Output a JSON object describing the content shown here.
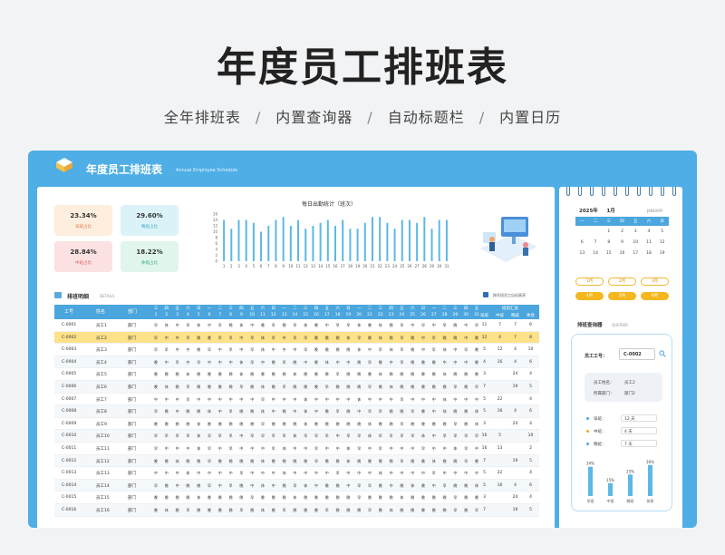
{
  "hero": {
    "title": "年度员工排班表",
    "features": [
      "全年排班表",
      "内置查询器",
      "自动标题栏",
      "内置日历"
    ],
    "separator": "/"
  },
  "app": {
    "title": "年度员工排班表",
    "subtitle": "Annual Employee Schedule",
    "colors": {
      "frame": "#4eaee5",
      "header": "#4aa6dd",
      "highlight": "#fde28a",
      "accent": "#f5b71f"
    }
  },
  "stats": [
    {
      "pct": "23.34%",
      "label": "早班占比"
    },
    {
      "pct": "29.60%",
      "label": "晚班占比"
    },
    {
      "pct": "28.84%",
      "label": "中班占比"
    },
    {
      "pct": "18.22%",
      "label": "休假占比"
    }
  ],
  "chart_data": {
    "type": "bar",
    "title": "每日出勤统计（班次）",
    "categories": [
      "1",
      "2",
      "3",
      "4",
      "5",
      "6",
      "7",
      "8",
      "9",
      "10",
      "11",
      "12",
      "13",
      "14",
      "15",
      "16",
      "17",
      "18",
      "19",
      "20",
      "21",
      "22",
      "23",
      "24",
      "25",
      "26",
      "27",
      "28",
      "29",
      "30",
      "31"
    ],
    "values": [
      14,
      11,
      14,
      14,
      13,
      10,
      12,
      14,
      15,
      12,
      14,
      11,
      12,
      13,
      14,
      12,
      14,
      11,
      11,
      13,
      15,
      15,
      13,
      11,
      14,
      14,
      13,
      15,
      11,
      14,
      14
    ],
    "ylim": [
      0,
      16
    ],
    "yticks": [
      "0",
      "2",
      "4",
      "6",
      "8",
      "10",
      "12",
      "14",
      "16"
    ],
    "color": "#5cb8e6"
  },
  "table": {
    "title": "排班明细",
    "subtitle": "DETAILS",
    "checkbox_label": "按早班员工自动高亮",
    "headers": {
      "id": "工号",
      "name": "姓名",
      "dept": "部门"
    },
    "weekdays": [
      "三",
      "四",
      "五",
      "六",
      "日",
      "一",
      "二",
      "三",
      "四",
      "五",
      "六",
      "日",
      "一",
      "二",
      "三",
      "四",
      "五",
      "六",
      "日",
      "一",
      "二",
      "三",
      "四",
      "五",
      "六",
      "日",
      "一",
      "二",
      "三",
      "四",
      "五"
    ],
    "days": [
      "1",
      "2",
      "3",
      "4",
      "5",
      "6",
      "7",
      "8",
      "9",
      "10",
      "11",
      "12",
      "13",
      "14",
      "15",
      "16",
      "17",
      "18",
      "19",
      "20",
      "21",
      "22",
      "23",
      "24",
      "25",
      "26",
      "27",
      "28",
      "29",
      "30",
      "31"
    ],
    "summary_title": "班组汇总",
    "summary_headers": [
      "早班",
      "中班",
      "晚班",
      "休息"
    ],
    "rows": [
      {
        "id": "C-0001",
        "name": "员工1",
        "dept": "部门",
        "shifts": "早休中早休中早晚休中晚早晚早休晚中早早休晚休晚早中早中早晚中早",
        "sums": [
          "11",
          "7",
          "7",
          "6"
        ]
      },
      {
        "id": "C-0002",
        "name": "员工2",
        "dept": "部门",
        "shifts": "早中中早晚晚早早中早休早中早早晚晚晚休早晚休晚早晚中早晚晚中晚",
        "sums": [
          "12",
          "4",
          "7",
          "8"
        ]
      },
      {
        "id": "C-0003",
        "name": "员工3",
        "dept": "部门",
        "shifts": "早早中中晚早中早中早休中中中早晚晚晚晚休中早休早晚中早休中早晚",
        "sums": [
          "5",
          "12",
          "4",
          "10"
        ]
      },
      {
        "id": "C-0004",
        "name": "员工4",
        "dept": "部门",
        "shifts": "晚中早中早中中中休早中晚早晚中晚休中中晚早晚中早晚晚晚中中中晚",
        "sums": [
          "4",
          "16",
          "4",
          "6"
        ]
      },
      {
        "id": "C-0005",
        "name": "员工5",
        "dept": "部门",
        "shifts": "晚晚晚休晚晚晚晚休晚晚晚晚休晚晚晚早晚晚晚休晚晚晚晚晚休晚晚晚",
        "sums": [
          "3",
          "",
          "24",
          "4"
        ]
      },
      {
        "id": "C-0006",
        "name": "员工6",
        "dept": "部门",
        "shifts": "晚休晚早晚晚晚晚早晚休晚早晚晚晚早晚晚晚早晚休晚晚晚晚晚早晚早",
        "sums": [
          "7",
          "",
          "19",
          "5"
        ]
      },
      {
        "id": "C-0007",
        "name": "员工7",
        "dept": "部门",
        "shifts": "中中中早中中中中中中早中中中休中中中中休中中中早中中中休中中中",
        "sums": [
          "5",
          "22",
          "",
          "4"
        ]
      },
      {
        "id": "C-0008",
        "name": "员工8",
        "dept": "部门",
        "shifts": "早晚中晚晚休中早晚晚休中晚中休中晚早晚中早早晚晚早晚中休晚晚休",
        "sums": [
          "5",
          "16",
          "4",
          "6"
        ]
      },
      {
        "id": "C-0009",
        "name": "员工9",
        "dept": "部门",
        "shifts": "晚晚晚晚休晚晚晚晚晚早晚晚晚休晚晚晚晚晚休晚晚早晚晚晚晚早晚休",
        "sums": [
          "3",
          "",
          "24",
          "4"
        ]
      },
      {
        "id": "C-0010",
        "name": "员工10",
        "dept": "部门",
        "shifts": "早早早早休早早早中早早早早休早早早中早早休早早早早休中早早早早",
        "sums": [
          "16",
          "5",
          "",
          "10"
        ]
      },
      {
        "id": "C-0011",
        "name": "员工11",
        "dept": "部门",
        "shifts": "早中中中休早中早中中中早休中中早中中休早中早中中中早中中休早中",
        "sums": [
          "16",
          "13",
          "",
          "2"
        ]
      },
      {
        "id": "C-0012",
        "name": "员工12",
        "dept": "部门",
        "shifts": "晚晚休晚晚早晚晚晚晚休晚晚晚晚早晚晚休晚晚晚晚早晚晚休晚晚早晚",
        "sums": [
          "7",
          "",
          "19",
          "5"
        ]
      },
      {
        "id": "C-0013",
        "name": "员工13",
        "dept": "部门",
        "shifts": "中中中休中中中中早中中中休中中中中早中中中休中中中中早中中中中",
        "sums": [
          "5",
          "22",
          "",
          "4"
        ]
      },
      {
        "id": "C-0014",
        "name": "员工14",
        "dept": "部门",
        "shifts": "早晚中晚晚早中早晚中休中晚早休中晚晚中早早晚中晚休晚中早晚晚休",
        "sums": [
          "5",
          "16",
          "4",
          "6"
        ]
      },
      {
        "id": "C-0015",
        "name": "员工15",
        "dept": "部门",
        "shifts": "晚晚晚晚休晚晚晚晚早晚晚晚休晚晚晚晚晚早晚晚晚休晚晚晚晚早晚晚",
        "sums": [
          "3",
          "",
          "24",
          "4"
        ]
      },
      {
        "id": "C-0016",
        "name": "员工16",
        "dept": "部门",
        "shifts": "晚休晚早晚晚晚晚早晚休晚早晚晚晚早晚晚晚早晚休晚晚晚晚晚早晚早",
        "sums": [
          "7",
          "",
          "19",
          "5"
        ]
      }
    ],
    "highlight_row": 1
  },
  "calendar": {
    "year_label": "2025年",
    "month_label": "1月",
    "month_en": "JANUARY",
    "weekdays": [
      "一",
      "二",
      "三",
      "四",
      "五",
      "六",
      "日"
    ],
    "weeks": [
      [
        "",
        "",
        "1",
        "2",
        "3",
        "4",
        "5"
      ],
      [
        "6",
        "7",
        "8",
        "9",
        "10",
        "11",
        "12"
      ],
      [
        "13",
        "14",
        "15",
        "16",
        "17",
        "18",
        "19"
      ]
    ],
    "months": [
      "1月",
      "2月",
      "3月",
      "4月",
      "5月",
      "6月"
    ],
    "selected_month": 0
  },
  "query": {
    "title": "排班查询器",
    "subtitle": "QUERIER",
    "id_label": "员工工号：",
    "id_value": "C-0002",
    "name_label": "员工姓名：",
    "name_value": "员工2",
    "dept_label": "所属部门：",
    "dept_value": "部门2",
    "shifts": [
      {
        "label": "早班：",
        "value": "12 天",
        "color": "#4aa6dd"
      },
      {
        "label": "中班：",
        "value": "4 天",
        "color": "#f5a623"
      },
      {
        "label": "晚班：",
        "value": "7 天",
        "color": "#4aa6dd"
      }
    ],
    "mini_chart": {
      "categories": [
        "早班",
        "中班",
        "晚班",
        "休息"
      ],
      "values": [
        34,
        15,
        25,
        36
      ],
      "labels": [
        "34%",
        "15%",
        "25%",
        "36%"
      ]
    }
  }
}
